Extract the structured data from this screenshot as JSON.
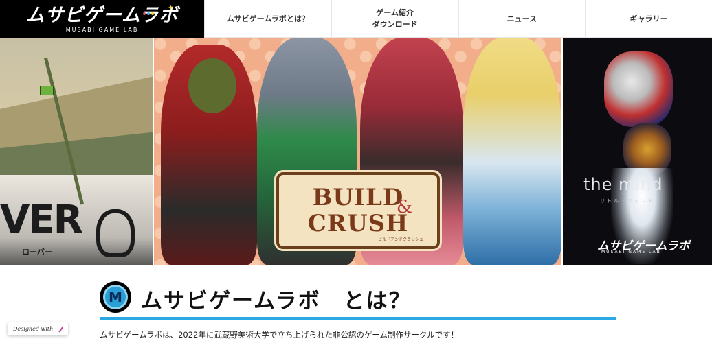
{
  "header": {
    "logo_text": "ムサビゲームラボ",
    "logo_sub": "MUSABI GAME LAB",
    "nav": [
      {
        "label": "ムサビゲームラボとは？"
      },
      {
        "label_line1": "ゲーム紹介",
        "label_line2": "ダウンロード"
      },
      {
        "label": "ニュース"
      },
      {
        "label": "ギャラリー"
      }
    ]
  },
  "hero": {
    "panels": [
      {
        "title": "VER",
        "kana": "ローバー"
      },
      {
        "title_line1": "BUILD",
        "title_line2": "CRUSH",
        "amp": "&",
        "sub": "ビルドアンドクラッシュ"
      },
      {
        "title": "the mind",
        "kana": "リトル・マインド",
        "logo_text": "ムサビゲームラボ",
        "logo_sub": "MUSABI GAME LAB"
      }
    ]
  },
  "about": {
    "icon_letter": "M",
    "title": "ムサビゲームラボ　とは？",
    "text": "ムサビゲームラボは、2022年に武蔵野美術大学で立ち上げられた非公認のゲーム制作サークルです！"
  },
  "badge": {
    "label": "Designed with"
  },
  "colors": {
    "accent": "#2aa9e4",
    "header_logo_bg": "#000000"
  }
}
